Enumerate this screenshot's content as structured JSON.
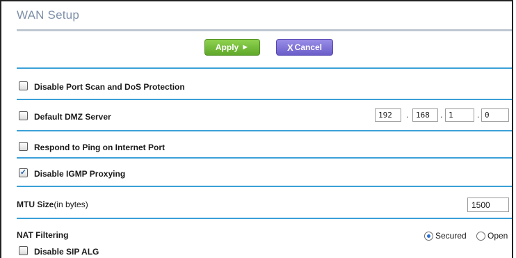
{
  "page": {
    "title": "WAN Setup"
  },
  "buttons": {
    "apply_label": "Apply",
    "apply_glyph": "►",
    "cancel_x": "X",
    "cancel_label": "Cancel"
  },
  "options": {
    "port_scan": {
      "label": "Disable Port Scan and DoS Protection",
      "checked": false
    },
    "dmz": {
      "label": "Default DMZ Server",
      "checked": false,
      "ip": [
        "192",
        "168",
        "1",
        "0"
      ]
    },
    "ping": {
      "label": "Respond to Ping on Internet Port",
      "checked": false
    },
    "igmp": {
      "label": "Disable IGMP Proxying",
      "checked": true
    }
  },
  "mtu": {
    "label_bold": "MTU Size",
    "label_unit": "(in bytes)",
    "value": "1500"
  },
  "nat": {
    "label": "NAT Filtering",
    "options": [
      {
        "label": "Secured",
        "selected": true
      },
      {
        "label": "Open",
        "selected": false
      }
    ]
  },
  "sip": {
    "label": "Disable SIP ALG",
    "checked": false
  },
  "colors": {
    "title": "#7d8fa8",
    "divider": "#3aa0d8",
    "apply": "#6cb82f",
    "cancel": "#7a6bd6"
  },
  "icons": {
    "checkmark": "check-icon",
    "apply_arrow": "play-arrow-icon"
  }
}
